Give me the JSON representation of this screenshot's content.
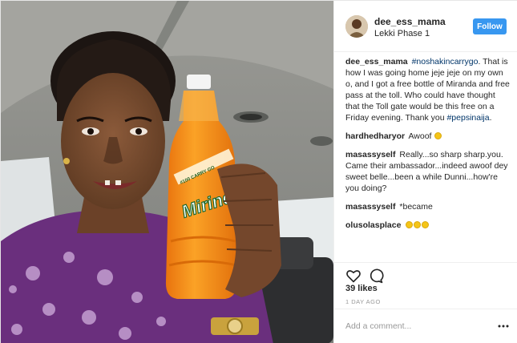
{
  "post": {
    "username": "dee_ess_mama",
    "location": "Lekki Phase 1",
    "follow_label": "Follow",
    "bottle_text": "Mirinda",
    "bottle_cap_text": "#100 CARRY GO",
    "icons": {
      "like": "heart-icon",
      "comment": "comment-bubble-icon",
      "more": "more-options-icon"
    }
  },
  "caption": {
    "user": "dee_ess_mama",
    "hashtag1": "#noshakincarrygo",
    "text1": ". That is how I was going home jeje jeje on my own o, and I got a free bottle of Miranda and free pass at the toll. Who could have thought that the Toll gate would be this free on a Friday evening. Thank you",
    "hashtag2": "#pepsinaija",
    "text2": "."
  },
  "comments": [
    {
      "user": "hardhedharyor",
      "text": "Awoof"
    },
    {
      "user": "masassyself",
      "text": "Really...so sharp sharp.you. Came their ambassador...indeed awoof dey sweet belle...been a while Dunni...how're you doing?"
    },
    {
      "user": "masassyself",
      "text": "*became"
    },
    {
      "user": "olusolasplace",
      "text": ""
    }
  ],
  "stats": {
    "likes": "39 likes",
    "time": "1 DAY AGO"
  },
  "add_comment": {
    "placeholder": "Add a comment..."
  },
  "colors": {
    "follow": "#3897f0",
    "hashtag": "#003569",
    "bottle": "#f5921e"
  }
}
